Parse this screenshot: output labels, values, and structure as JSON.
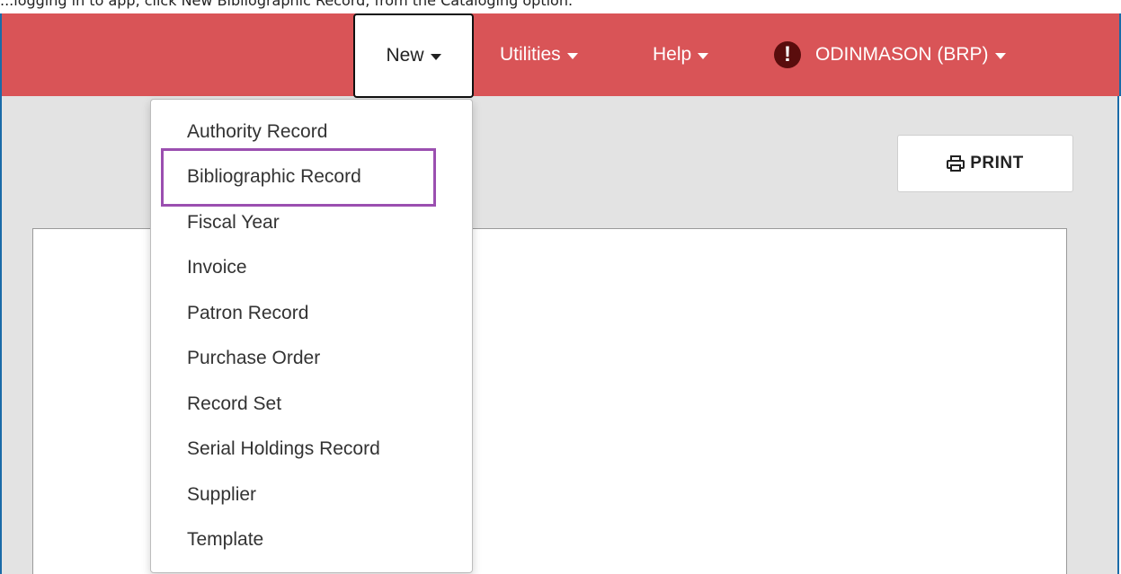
{
  "caption": "...logging in to app, click New Bibliographic Record, from the Cataloging option.",
  "navbar": {
    "new_label": "New",
    "utilities_label": "Utilities",
    "help_label": "Help",
    "alert_glyph": "!",
    "user_label": "ODINMASON (BRP)",
    "bg_color": "#d95457"
  },
  "toolbar": {
    "print_label": "PRINT"
  },
  "dropdown": {
    "items": [
      "Authority Record",
      "Bibliographic Record",
      "Fiscal Year",
      "Invoice",
      "Patron Record",
      "Purchase Order",
      "Record Set",
      "Serial Holdings Record",
      "Supplier",
      "Template"
    ],
    "highlighted_item": "Bibliographic Record",
    "highlight_color": "#9b4fb0"
  }
}
